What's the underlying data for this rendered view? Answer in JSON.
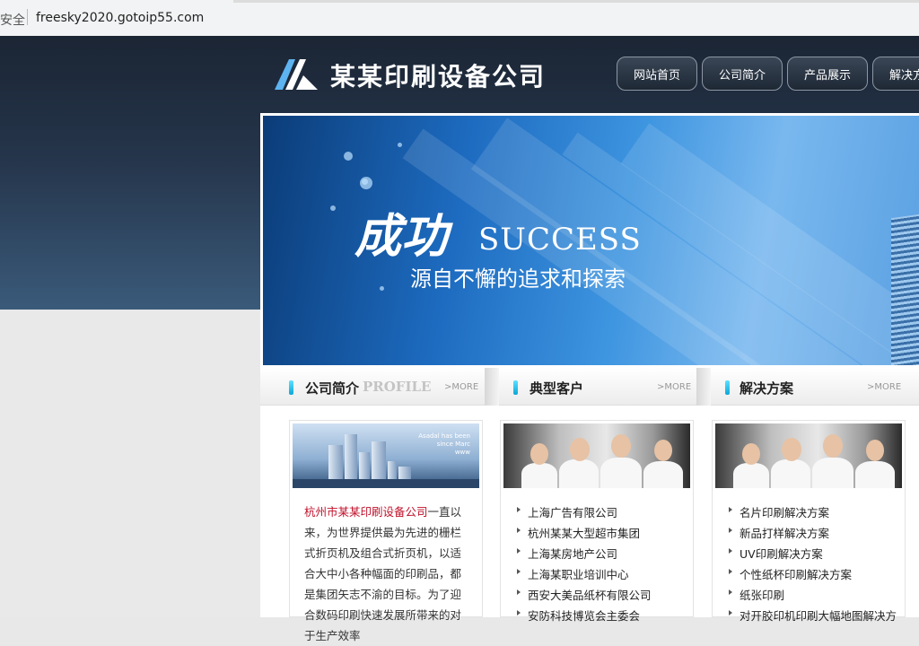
{
  "browser": {
    "security_label": "安全",
    "url": "freesky2020.gotoip55.com"
  },
  "site": {
    "logo_text": "某某印刷设备公司",
    "nav": [
      "网站首页",
      "公司简介",
      "产品展示",
      "解决方案"
    ]
  },
  "banner": {
    "title_cn": "成功",
    "title_en": "SUCCESS",
    "subtitle": "源自不懈的追求和探索"
  },
  "sections": {
    "profile": {
      "title": "公司简介",
      "subtitle": "PROFILE",
      "more": ">MORE",
      "image_caption": "Asadal has been\nsince Marc\nwww",
      "company_name": "杭州市某某印刷设备公司",
      "text": "一直以来，为世界提供最为先进的栅栏式折页机及组合式折页机，以适合大中小各种幅面的印刷品，都是集团矢志不渝的目标。为了迎合数码印刷快速发展所带来的对于生产效率"
    },
    "clients": {
      "title": "典型客户",
      "more": ">MORE",
      "items": [
        "上海广告有限公司",
        "杭州某某大型超市集团",
        "上海某房地产公司",
        "上海某职业培训中心",
        "西安大美品纸杯有限公司",
        "安防科技博览会主委会"
      ]
    },
    "solutions": {
      "title": "解决方案",
      "more": ">MORE",
      "items": [
        "名片印刷解决方案",
        "新品打样解决方案",
        "UV印刷解决方案",
        "个性纸杯印刷解决方案",
        "纸张印刷",
        "对开胶印机印刷大幅地图解决方"
      ]
    }
  },
  "colors": {
    "header_dark": "#1b2534",
    "accent_cyan": "#0aa7d8",
    "highlight_red": "#c0102a"
  }
}
